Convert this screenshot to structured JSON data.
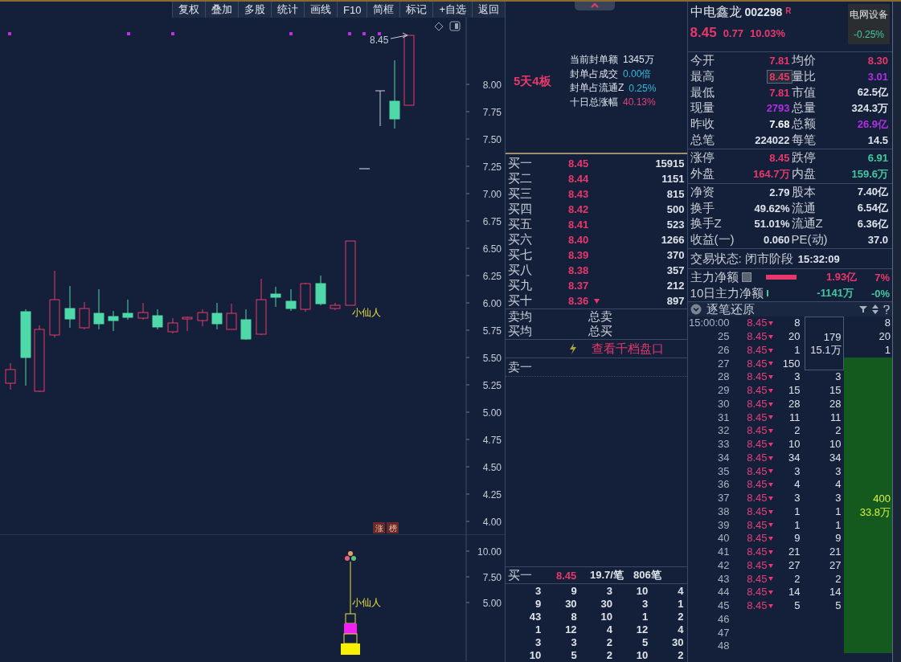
{
  "toolbar": [
    {
      "label": "复权"
    },
    {
      "label": "叠加"
    },
    {
      "label": "多股"
    },
    {
      "label": "统计"
    },
    {
      "label": "画线"
    },
    {
      "label": "F10"
    },
    {
      "label": "简框"
    },
    {
      "label": "标记"
    },
    {
      "label": "+自选"
    },
    {
      "label": "返回"
    }
  ],
  "chart": {
    "price_axis": [
      "8.00",
      "7.75",
      "7.50",
      "7.25",
      "7.00",
      "6.75",
      "6.50",
      "6.25",
      "6.00",
      "5.75",
      "5.50",
      "5.25",
      "5.00",
      "4.75",
      "4.50",
      "4.25",
      "4.00"
    ],
    "price_label": "8.45",
    "pattern_label": "小仙人",
    "badges": [
      "涨",
      "榜"
    ],
    "indicator_axis": [
      "10.00",
      "7.50",
      "5.00"
    ],
    "indicator_label": "小仙人"
  },
  "streak": "5天4板",
  "seal_info": [
    {
      "label": "当前封单额",
      "value": "1345万",
      "color": "#dfe3ea"
    },
    {
      "label": "封单占成交",
      "value": "0.00倍",
      "color": "#38b8d8"
    },
    {
      "label": "封单占流通Z",
      "value": "0.25%",
      "color": "#38b8d8"
    },
    {
      "label": "十日总涨幅",
      "value": "40.13%",
      "color": "#e0407a"
    }
  ],
  "bids": [
    {
      "label": "买一",
      "price": "8.45",
      "volume": "15915",
      "marked": false
    },
    {
      "label": "买二",
      "price": "8.44",
      "volume": "1151",
      "marked": false
    },
    {
      "label": "买三",
      "price": "8.43",
      "volume": "815",
      "marked": false
    },
    {
      "label": "买四",
      "price": "8.42",
      "volume": "500",
      "marked": false
    },
    {
      "label": "买五",
      "price": "8.41",
      "volume": "523",
      "marked": false
    },
    {
      "label": "买六",
      "price": "8.40",
      "volume": "1266",
      "marked": false
    },
    {
      "label": "买七",
      "price": "8.39",
      "volume": "370",
      "marked": false
    },
    {
      "label": "买八",
      "price": "8.38",
      "volume": "357",
      "marked": false
    },
    {
      "label": "买九",
      "price": "8.37",
      "volume": "212",
      "marked": false
    },
    {
      "label": "买十",
      "price": "8.36",
      "volume": "897",
      "marked": true
    }
  ],
  "averages": [
    {
      "label": "卖均",
      "total": "总卖"
    },
    {
      "label": "买均",
      "total": "总买"
    }
  ],
  "depth_link": "查看千档盘口",
  "ask_row": "卖一",
  "queue": {
    "label": "买一",
    "price": "8.45",
    "average": "19.7/笔",
    "count": "806笔",
    "rows": [
      [
        "3",
        "9",
        "3",
        "10",
        "4"
      ],
      [
        "9",
        "30",
        "30",
        "3",
        "1"
      ],
      [
        "43",
        "8",
        "10",
        "1",
        "2"
      ],
      [
        "1",
        "12",
        "4",
        "12",
        "4"
      ],
      [
        "3",
        "3",
        "2",
        "5",
        "30"
      ],
      [
        "10",
        "5",
        "2",
        "10",
        "2"
      ]
    ]
  },
  "quote": {
    "name": "中电鑫龙",
    "code": "002298",
    "flag": "R",
    "price": "8.45",
    "change": "0.77",
    "percent": "10.03%",
    "sector": "电网设备",
    "sector_change": "-0.25%"
  },
  "stats": [
    [
      [
        {
          "label": "今开",
          "value": "7.81",
          "color": "#e8386b",
          "boxed": false
        },
        {
          "label": "均价",
          "value": "8.30",
          "color": "#e8386b",
          "boxed": false
        }
      ],
      [
        {
          "label": "最高",
          "value": "8.45",
          "color": "#e8386b",
          "boxed": true
        },
        {
          "label": "量比",
          "value": "3.01",
          "color": "#b030e0",
          "boxed": false
        }
      ],
      [
        {
          "label": "最低",
          "value": "7.81",
          "color": "#e8386b",
          "boxed": false
        },
        {
          "label": "市值",
          "value": "62.5亿",
          "color": "#dfe3ea",
          "boxed": false
        }
      ],
      [
        {
          "label": "现量",
          "value": "2793",
          "color": "#b030e0",
          "boxed": false
        },
        {
          "label": "总量",
          "value": "324.3万",
          "color": "#dfe3ea",
          "boxed": false
        }
      ],
      [
        {
          "label": "昨收",
          "value": "7.68",
          "color": "#ffffff",
          "boxed": false
        },
        {
          "label": "总额",
          "value": "26.9亿",
          "color": "#b030e0",
          "boxed": false
        }
      ],
      [
        {
          "label": "总笔",
          "value": "224022",
          "color": "#dfe3ea",
          "boxed": false
        },
        {
          "label": "每笔",
          "value": "14.5",
          "color": "#dfe3ea",
          "boxed": false
        }
      ]
    ],
    [
      [
        {
          "label": "涨停",
          "value": "8.45",
          "color": "#e8386b",
          "boxed": false
        },
        {
          "label": "跌停",
          "value": "6.91",
          "color": "#41c8a0",
          "boxed": false
        }
      ],
      [
        {
          "label": "外盘",
          "value": "164.7万",
          "color": "#e8386b",
          "boxed": false
        },
        {
          "label": "内盘",
          "value": "159.6万",
          "color": "#41c8a0",
          "boxed": false
        }
      ]
    ],
    [
      [
        {
          "label": "净资",
          "value": "2.79",
          "color": "#dfe3ea",
          "boxed": false
        },
        {
          "label": "股本",
          "value": "7.40亿",
          "color": "#dfe3ea",
          "boxed": false
        }
      ],
      [
        {
          "label": "换手",
          "value": "49.62%",
          "color": "#dfe3ea",
          "boxed": false
        },
        {
          "label": "流通",
          "value": "6.54亿",
          "color": "#dfe3ea",
          "boxed": false
        }
      ],
      [
        {
          "label": "换手Z",
          "value": "51.01%",
          "color": "#dfe3ea",
          "boxed": false
        },
        {
          "label": "流通Z",
          "value": "6.36亿",
          "color": "#dfe3ea",
          "boxed": false
        }
      ],
      [
        {
          "label": "收益(一)",
          "value": "0.060",
          "color": "#dfe3ea",
          "boxed": false
        },
        {
          "label": "PE(动)",
          "value": "37.0",
          "color": "#dfe3ea",
          "boxed": false
        }
      ]
    ]
  ],
  "status": {
    "label": "交易状态:",
    "phase": "闭市阶段",
    "time": "15:32:09"
  },
  "flows": [
    {
      "kind": "bar",
      "label": "主力净额",
      "value": "1.93亿",
      "percent": "7%",
      "color": "#e8386b"
    },
    {
      "kind": "tick",
      "label": "10日主力净额",
      "value": "-1141万",
      "percent": "-0%",
      "color": "#41c8a0"
    }
  ],
  "ticks": {
    "title": "逐笔还原",
    "order_block": [
      "179",
      "15.1万"
    ],
    "trade_block": [
      "400",
      "33.8万"
    ],
    "rows": [
      {
        "time": "15:00:00",
        "price": "8.45",
        "falling": true,
        "volume": "8",
        "trade": "8"
      },
      {
        "time": "25",
        "price": "8.45",
        "falling": true,
        "volume": "20",
        "trade": "20"
      },
      {
        "time": "26",
        "price": "8.45",
        "falling": true,
        "volume": "1",
        "trade": "1"
      },
      {
        "time": "27",
        "price": "8.45",
        "falling": true,
        "volume": "150"
      },
      {
        "time": "28",
        "price": "8.45",
        "falling": true,
        "volume": "3",
        "order": "3"
      },
      {
        "time": "29",
        "price": "8.45",
        "falling": true,
        "volume": "15",
        "order": "15"
      },
      {
        "time": "30",
        "price": "8.45",
        "falling": true,
        "volume": "28",
        "order": "28"
      },
      {
        "time": "31",
        "price": "8.45",
        "falling": true,
        "volume": "11",
        "order": "11"
      },
      {
        "time": "32",
        "price": "8.45",
        "falling": true,
        "volume": "2",
        "order": "2"
      },
      {
        "time": "33",
        "price": "8.45",
        "falling": true,
        "volume": "10",
        "order": "10"
      },
      {
        "time": "34",
        "price": "8.45",
        "falling": true,
        "volume": "34",
        "order": "34"
      },
      {
        "time": "35",
        "price": "8.45",
        "falling": true,
        "volume": "3",
        "order": "3"
      },
      {
        "time": "36",
        "price": "8.45",
        "falling": true,
        "volume": "4",
        "order": "4"
      },
      {
        "time": "37",
        "price": "8.45",
        "falling": true,
        "volume": "3",
        "order": "3"
      },
      {
        "time": "38",
        "price": "8.45",
        "falling": true,
        "volume": "1",
        "order": "1"
      },
      {
        "time": "39",
        "price": "8.45",
        "falling": true,
        "volume": "1",
        "order": "1"
      },
      {
        "time": "40",
        "price": "8.45",
        "falling": true,
        "volume": "9",
        "order": "9"
      },
      {
        "time": "41",
        "price": "8.45",
        "falling": true,
        "volume": "21",
        "order": "21"
      },
      {
        "time": "42",
        "price": "8.45",
        "falling": true,
        "volume": "27",
        "order": "27"
      },
      {
        "time": "43",
        "price": "8.45",
        "falling": true,
        "volume": "2",
        "order": "2"
      },
      {
        "time": "44",
        "price": "8.45",
        "falling": true,
        "volume": "14",
        "order": "14"
      },
      {
        "time": "45",
        "price": "8.45",
        "falling": true,
        "volume": "5",
        "order": "5"
      },
      {
        "time": "46"
      },
      {
        "time": "47"
      },
      {
        "time": "48"
      }
    ]
  }
}
